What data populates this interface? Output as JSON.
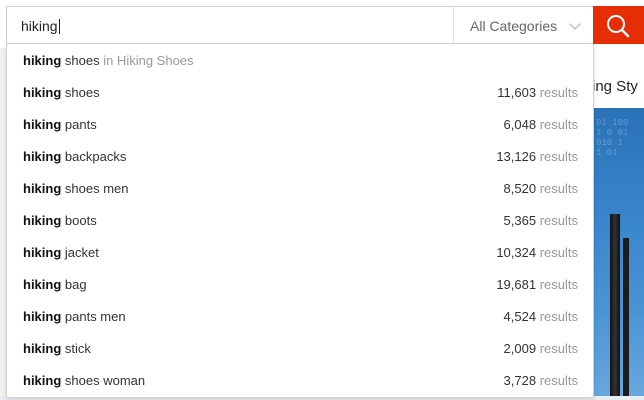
{
  "search": {
    "query": "hiking",
    "category": "All Categories"
  },
  "background": {
    "headline_fragment": "ing Sty"
  },
  "dropdown": {
    "scoped": {
      "keyword": "hiking",
      "rest": " shoes",
      "scope_text": " in Hiking Shoes"
    },
    "result_unit": "results",
    "suggestions": [
      {
        "keyword": "hiking",
        "rest": " shoes",
        "count": "11,603"
      },
      {
        "keyword": "hiking",
        "rest": " pants",
        "count": "6,048"
      },
      {
        "keyword": "hiking",
        "rest": " backpacks",
        "count": "13,126"
      },
      {
        "keyword": "hiking",
        "rest": " shoes men",
        "count": "8,520"
      },
      {
        "keyword": "hiking",
        "rest": " boots",
        "count": "5,365"
      },
      {
        "keyword": "hiking",
        "rest": " jacket",
        "count": "10,324"
      },
      {
        "keyword": "hiking",
        "rest": " bag",
        "count": "19,681"
      },
      {
        "keyword": "hiking",
        "rest": " pants men",
        "count": "4,524"
      },
      {
        "keyword": "hiking",
        "rest": " stick",
        "count": "2,009"
      },
      {
        "keyword": "hiking",
        "rest": " shoes woman",
        "count": "3,728"
      }
    ]
  },
  "colors": {
    "search_button": "#e62e04"
  },
  "icons": {
    "search_button": "search-icon",
    "category_dropdown": "chevron-down-icon"
  }
}
